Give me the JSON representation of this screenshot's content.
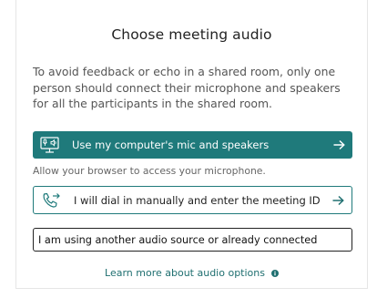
{
  "dialog": {
    "title": "Choose meeting audio",
    "description": "To avoid feedback or echo in a shared room, only one person should connect their microphone and speakers for all the participants in the shared room.",
    "computer_audio_button": {
      "label": "Use my computer's mic and speakers",
      "icon": "computer-mic-speaker-icon"
    },
    "permission_hint": "Allow your browser to access your microphone.",
    "dial_in_button": {
      "label": "I will dial in manually and enter the meeting ID",
      "icon": "phone-outgoing-icon"
    },
    "other_source_button": {
      "label": "I am using another audio source or already connected"
    },
    "learn_more_link": {
      "label": "Learn more about audio options",
      "icon": "info-icon"
    }
  },
  "colors": {
    "accent": "#1f7a7b",
    "text": "#222222",
    "muted_text": "#555555"
  }
}
